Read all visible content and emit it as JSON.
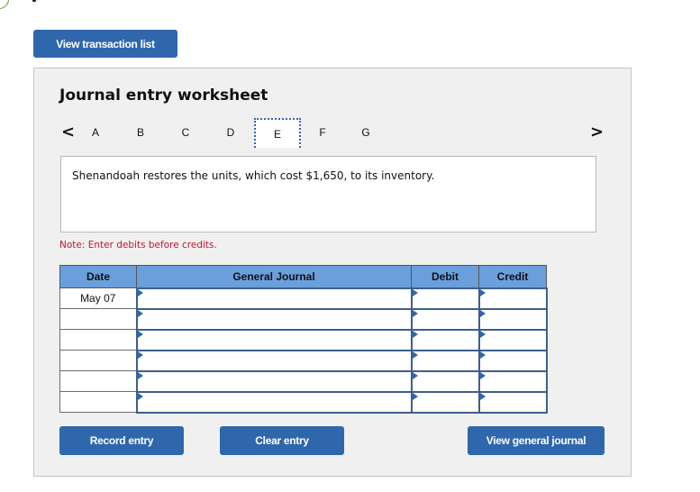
{
  "top_button": {
    "label": "View transaction list"
  },
  "worksheet": {
    "title": "Journal entry worksheet",
    "nav": {
      "prev_icon": "chevron-left-icon",
      "next_icon": "chevron-right-icon",
      "prev_glyph": "<",
      "next_glyph": ">",
      "tabs": [
        {
          "label": "A",
          "active": false
        },
        {
          "label": "B",
          "active": false
        },
        {
          "label": "C",
          "active": false
        },
        {
          "label": "D",
          "active": false
        },
        {
          "label": "E",
          "active": true
        },
        {
          "label": "F",
          "active": false
        },
        {
          "label": "G",
          "active": false
        }
      ]
    },
    "description": "Shenandoah restores the units, which cost $1,650, to its inventory.",
    "note": "Note: Enter debits before credits.",
    "table": {
      "headers": [
        "Date",
        "General Journal",
        "Debit",
        "Credit"
      ],
      "rows": [
        {
          "date": "May 07",
          "account": "",
          "debit": "",
          "credit": ""
        },
        {
          "date": "",
          "account": "",
          "debit": "",
          "credit": ""
        },
        {
          "date": "",
          "account": "",
          "debit": "",
          "credit": ""
        },
        {
          "date": "",
          "account": "",
          "debit": "",
          "credit": ""
        },
        {
          "date": "",
          "account": "",
          "debit": "",
          "credit": ""
        },
        {
          "date": "",
          "account": "",
          "debit": "",
          "credit": ""
        }
      ]
    },
    "buttons": {
      "record": "Record entry",
      "clear": "Clear entry",
      "view_journal": "View general journal"
    }
  },
  "colors": {
    "button_blue": "#2f67ad",
    "header_blue": "#6a9fdc",
    "note_red": "#c0182a",
    "panel_bg": "#f0f0f0"
  }
}
